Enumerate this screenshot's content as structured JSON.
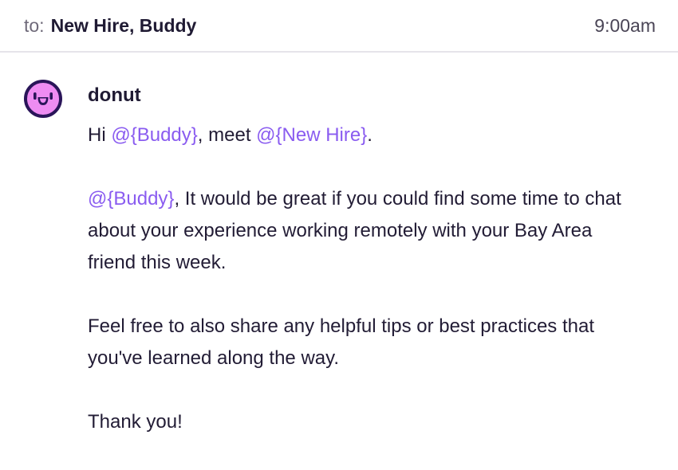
{
  "header": {
    "to_label": "to:",
    "recipients": [
      "New Hire",
      "Buddy"
    ],
    "separator": ",",
    "time": "9:00am"
  },
  "message": {
    "sender": "donut",
    "avatar_icon": "donut-face-icon",
    "colors": {
      "mention": "#8a5cf0",
      "avatar_bg": "#ee8cf2",
      "avatar_ring": "#2a1559"
    },
    "greeting": {
      "prefix": "Hi ",
      "mention_1": "@{Buddy}",
      "middle": ", meet ",
      "mention_2": "@{New Hire}",
      "suffix": "."
    },
    "request": {
      "mention": "@{Buddy}",
      "line_1": ", It would be great if you could find some time to chat",
      "line_2": "about your experience working remotely with your Bay Area",
      "line_3": "friend this week."
    },
    "tips": {
      "line_1": "Feel free to also share any helpful tips or best practices that",
      "line_2": "you've learned along the way."
    },
    "closing": "Thank you!"
  }
}
